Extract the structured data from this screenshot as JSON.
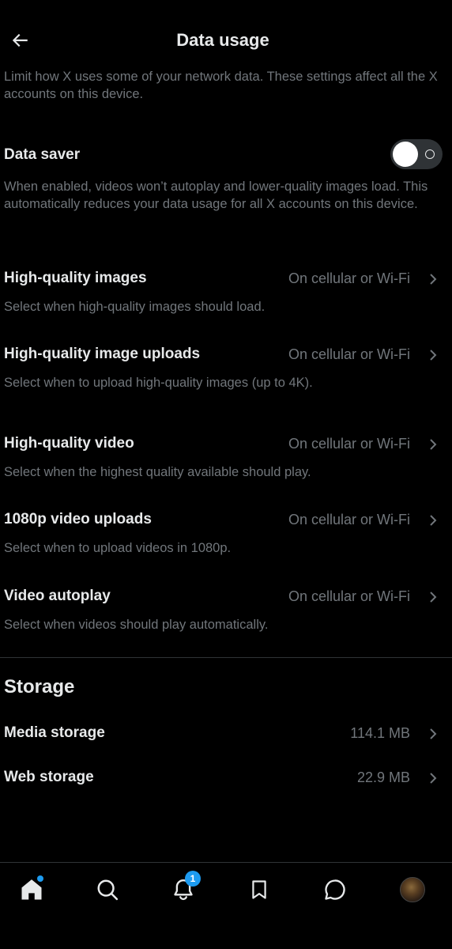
{
  "header": {
    "title": "Data usage"
  },
  "intro": "Limit how X uses some of your network data. These settings affect all the X accounts on this device.",
  "data_saver": {
    "label": "Data saver",
    "enabled": false,
    "description": "When enabled, videos won’t autoplay and lower-quality images load. This automatically reduces your data usage for all X accounts on this device."
  },
  "settings": [
    {
      "name": "High-quality images",
      "value": "On cellular or Wi-Fi",
      "description": "Select when high-quality images should load."
    },
    {
      "name": "High-quality image uploads",
      "value": "On cellular or Wi-Fi",
      "description": "Select when to upload high-quality images (up to 4K)."
    },
    {
      "name": "High-quality video",
      "value": "On cellular or Wi-Fi",
      "description": "Select when the highest quality available should play."
    },
    {
      "name": "1080p video uploads",
      "value": "On cellular or Wi-Fi",
      "description": "Select when to upload videos in 1080p."
    },
    {
      "name": "Video autoplay",
      "value": "On cellular or Wi-Fi",
      "description": "Select when videos should play automatically."
    }
  ],
  "storage": {
    "heading": "Storage",
    "items": [
      {
        "name": "Media storage",
        "value": "114.1 MB"
      },
      {
        "name": "Web storage",
        "value": "22.9 MB"
      }
    ]
  },
  "nav": {
    "notifications_badge": "1",
    "icons": [
      "home-icon",
      "search-icon",
      "bell-icon",
      "bookmark-icon",
      "message-icon",
      "avatar"
    ]
  },
  "colors": {
    "background": "#000000",
    "primary_text": "#e7e9ea",
    "secondary_text": "#71767b",
    "accent": "#1d9bf0",
    "divider": "#2f3336"
  }
}
